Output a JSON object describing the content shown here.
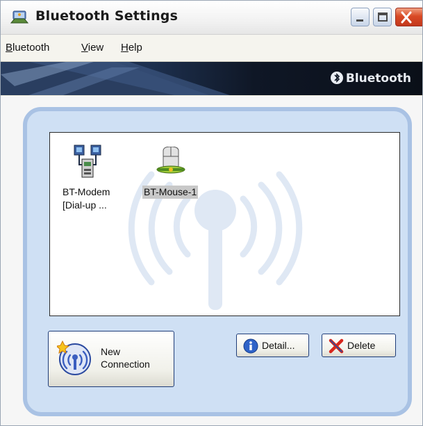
{
  "window": {
    "title": "Bluetooth Settings",
    "controls": {
      "minimize": "minimize",
      "maximize": "maximize",
      "close": "close"
    }
  },
  "menu": [
    {
      "label": "Bluetooth",
      "mnemonic": "B"
    },
    {
      "label": "View",
      "mnemonic": "V"
    },
    {
      "label": "Help",
      "mnemonic": "H"
    }
  ],
  "banner": {
    "logo_text": "Bluetooth"
  },
  "devices": [
    {
      "label_line1": "BT-Modem",
      "label_line2": "[Dial-up ...",
      "icon": "modem-icon",
      "selected": false
    },
    {
      "label_line1": "BT-Mouse-1",
      "label_line2": "",
      "icon": "mouse-icon",
      "selected": true
    }
  ],
  "buttons": {
    "new_connection_line1": "New",
    "new_connection_line2": "Connection",
    "detail": "Detail...",
    "delete": "Delete"
  },
  "colors": {
    "panel": "#cfe0f4",
    "panel_border": "#a9c2e4",
    "close_button": "#d94a25",
    "selection": "#c8c8c8"
  }
}
